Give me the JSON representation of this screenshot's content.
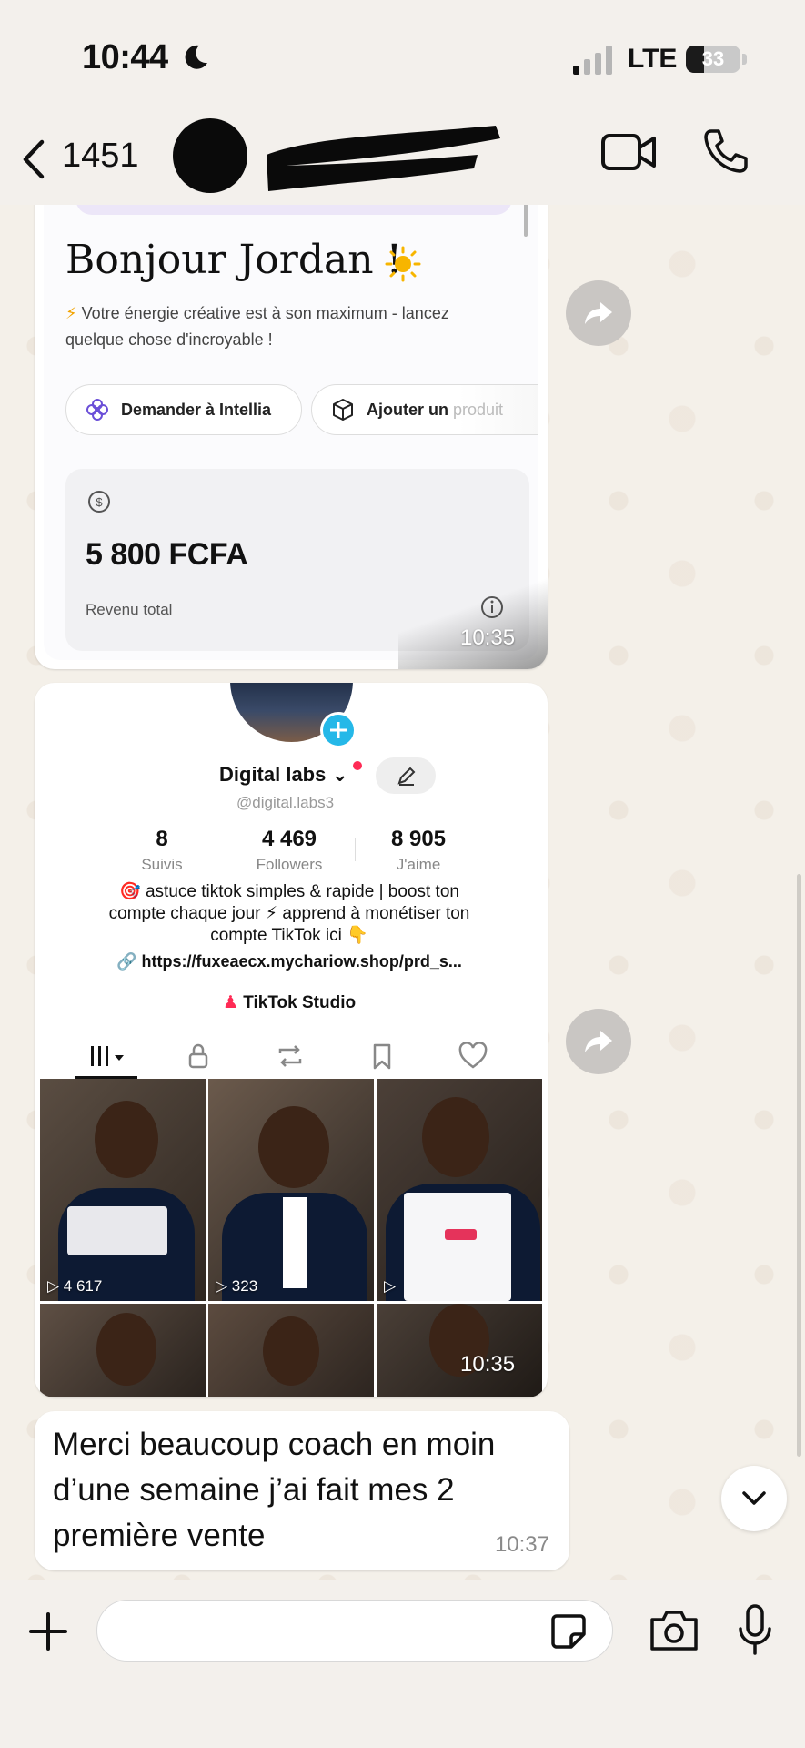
{
  "status_bar": {
    "time": "10:44",
    "network": "LTE",
    "battery": "33",
    "battery_level": 0.33
  },
  "header": {
    "back_count": "1451"
  },
  "messages": [
    {
      "type": "image",
      "timestamp": "10:35",
      "content": {
        "greeting": "Bonjour Jordan !",
        "subtitle": "Votre énergie créative est à son maximum - lancez quelque chose d'incroyable !",
        "button_ask": "Demander à Intellia",
        "button_add": "Ajouter un",
        "button_add_faded": "produit",
        "amount": "5 800 FCFA",
        "amount_label": "Revenu total"
      }
    },
    {
      "type": "image",
      "timestamp": "10:35",
      "content": {
        "profile_name": "Digital labs",
        "handle": "@digital.labs3",
        "stats": [
          {
            "value": "8",
            "label": "Suivis"
          },
          {
            "value": "4 469",
            "label": "Followers"
          },
          {
            "value": "8 905",
            "label": "J'aime"
          }
        ],
        "bio_line1": "astuce tiktok simples & rapide | boost ton",
        "bio_line2": "compte chaque jour ⚡ apprend à monétiser ton",
        "bio_line3": "compte TikTok ici 👇",
        "link": "https://fuxeaecx.mychariow.shop/prd_s...",
        "studio": "TikTok Studio",
        "video_counts": [
          "4 617",
          "323",
          ""
        ]
      }
    },
    {
      "type": "text",
      "text": "Merci beaucoup coach en moin d’une semaine j’ai fait mes 2 première vente",
      "timestamp": "10:37"
    }
  ],
  "icons": {
    "back": "chevron-left-icon",
    "video": "video-call-icon",
    "phone": "phone-icon",
    "forward": "forward-icon",
    "plus": "plus-icon",
    "sticker": "sticker-icon",
    "camera": "camera-icon",
    "mic": "microphone-icon"
  },
  "colors": {
    "wallpaper": "#f4f0e9",
    "bubble": "#ffffff",
    "tiktok_accent": "#25b8e8"
  }
}
